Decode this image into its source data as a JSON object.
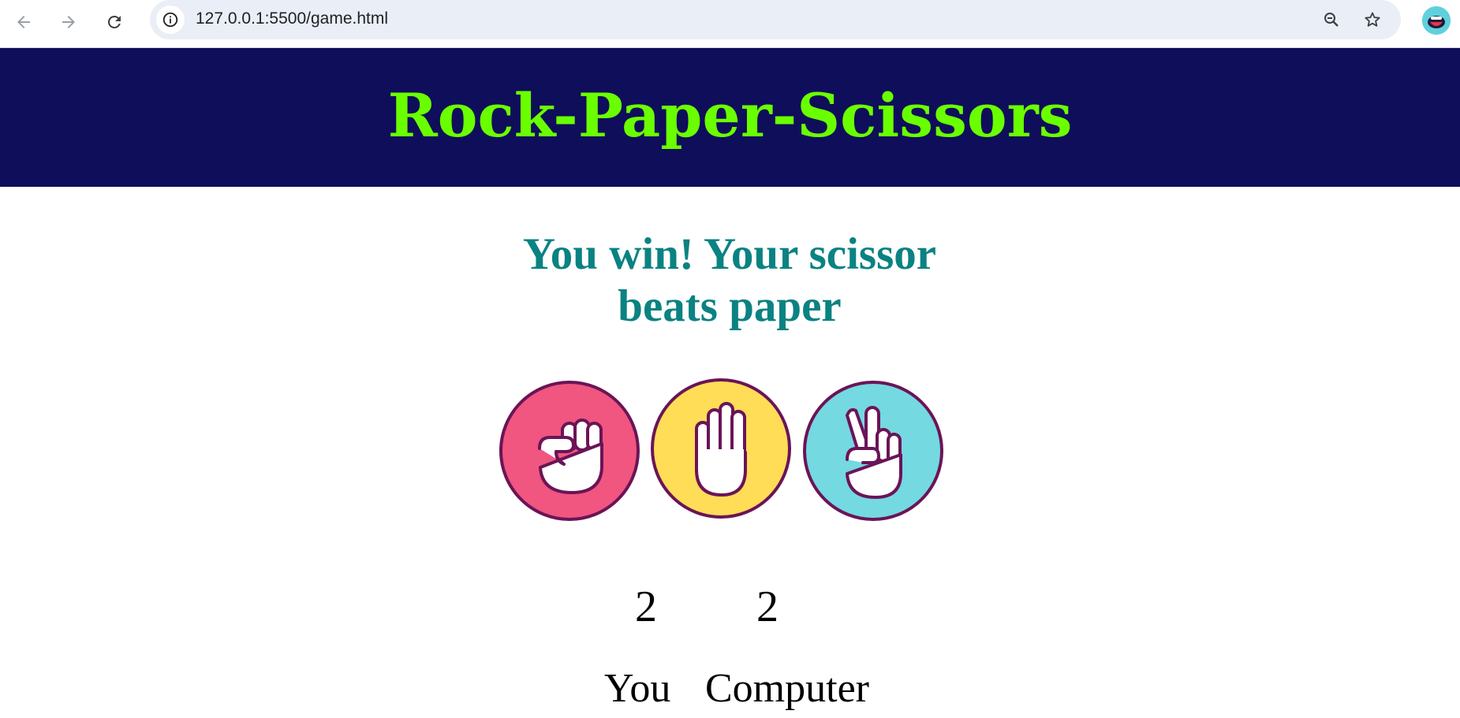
{
  "browser": {
    "url": "127.0.0.1:5500/game.html"
  },
  "game": {
    "title": "Rock-Paper-Scissors",
    "result_line1": "You win! Your scissor",
    "result_line2": "beats paper",
    "choices": [
      {
        "id": "rock",
        "color": "#f0567f"
      },
      {
        "id": "paper",
        "color": "#ffdd57"
      },
      {
        "id": "scissors",
        "color": "#74d9e1"
      }
    ],
    "score": {
      "user": "2",
      "computer": "2",
      "user_label": "You",
      "computer_label": "Computer"
    }
  },
  "colors": {
    "header_bg": "#0e0e5a",
    "title": "#6aff00",
    "result": "#0b8282",
    "choice_border": "#6b1457"
  }
}
